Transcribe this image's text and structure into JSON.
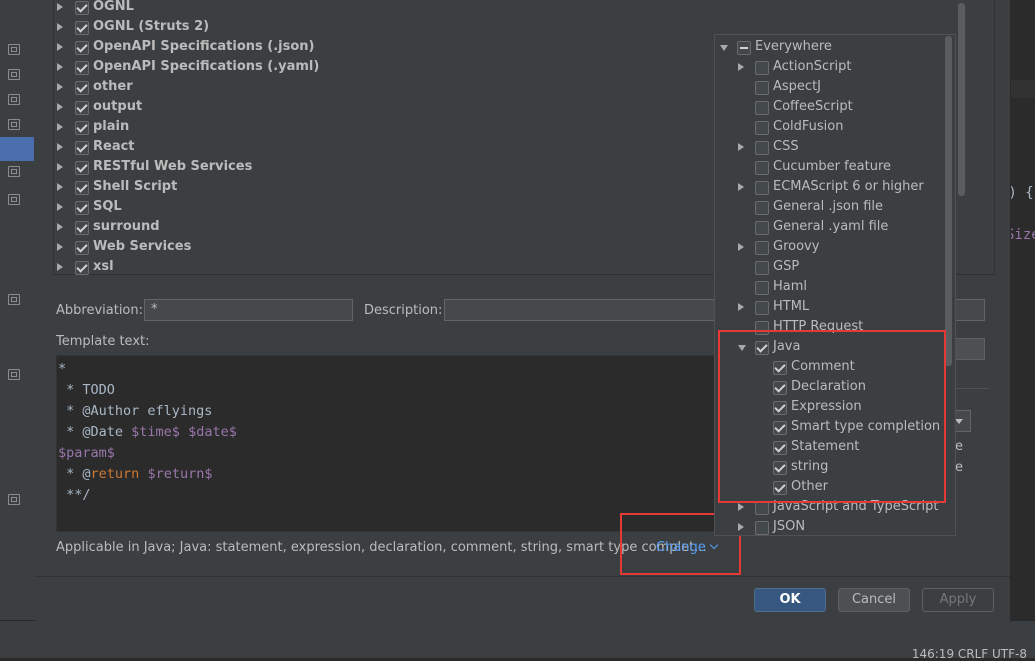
{
  "ide": {
    "code_fragment_1": "e) {",
    "code_fragment_2": "Size",
    "status": "146:19   CRLF   UTF-8"
  },
  "template_groups": [
    {
      "label": "OGNL",
      "checked": true
    },
    {
      "label": "OGNL (Struts 2)",
      "checked": true
    },
    {
      "label": "OpenAPI Specifications (.json)",
      "checked": true
    },
    {
      "label": "OpenAPI Specifications (.yaml)",
      "checked": true
    },
    {
      "label": "other",
      "checked": true
    },
    {
      "label": "output",
      "checked": true
    },
    {
      "label": "plain",
      "checked": true
    },
    {
      "label": "React",
      "checked": true
    },
    {
      "label": "RESTful Web Services",
      "checked": true
    },
    {
      "label": "Shell Script",
      "checked": true
    },
    {
      "label": "SQL",
      "checked": true
    },
    {
      "label": "surround",
      "checked": true
    },
    {
      "label": "Web Services",
      "checked": true
    },
    {
      "label": "xsl",
      "checked": true
    }
  ],
  "form": {
    "abbreviation_label": "Abbreviation:",
    "abbreviation_value": "*",
    "description_label": "Description:",
    "description_value": "",
    "template_text_label": "Template text:",
    "template_lines": [
      {
        "text": "*"
      },
      {
        "text": " * TODO"
      },
      {
        "text": " * @Author eflyings"
      },
      {
        "prefix": " * @Date ",
        "var1": "$time$",
        "sep": " ",
        "var2": "$date$"
      },
      {
        "var": "$param$"
      },
      {
        "prefix": " * @",
        "kw": "return",
        "sep": " ",
        "var": "$return$"
      },
      {
        "text": " **/"
      }
    ],
    "applicable_text": "Applicable in Java; Java: statement, expression, declaration, comment, string, smart type complet...",
    "change_link": "Change",
    "edge_text_1": "e",
    "edge_text_2": "e"
  },
  "buttons": {
    "ok": "OK",
    "cancel": "Cancel",
    "apply": "Apply"
  },
  "context_popup": {
    "items": [
      {
        "label": "Everywhere",
        "state": "partial",
        "level": 0,
        "arrow": "down"
      },
      {
        "label": "ActionScript",
        "state": "unchecked",
        "level": 1,
        "arrow": "right"
      },
      {
        "label": "AspectJ",
        "state": "unchecked",
        "level": 1,
        "arrow": "none"
      },
      {
        "label": "CoffeeScript",
        "state": "unchecked",
        "level": 1,
        "arrow": "none"
      },
      {
        "label": "ColdFusion",
        "state": "unchecked",
        "level": 1,
        "arrow": "none"
      },
      {
        "label": "CSS",
        "state": "unchecked",
        "level": 1,
        "arrow": "right"
      },
      {
        "label": "Cucumber feature",
        "state": "unchecked",
        "level": 1,
        "arrow": "none"
      },
      {
        "label": "ECMAScript 6 or higher",
        "state": "unchecked",
        "level": 1,
        "arrow": "right"
      },
      {
        "label": "General .json file",
        "state": "unchecked",
        "level": 1,
        "arrow": "none"
      },
      {
        "label": "General .yaml file",
        "state": "unchecked",
        "level": 1,
        "arrow": "none"
      },
      {
        "label": "Groovy",
        "state": "unchecked",
        "level": 1,
        "arrow": "right"
      },
      {
        "label": "GSP",
        "state": "unchecked",
        "level": 1,
        "arrow": "none"
      },
      {
        "label": "Haml",
        "state": "unchecked",
        "level": 1,
        "arrow": "none"
      },
      {
        "label": "HTML",
        "state": "unchecked",
        "level": 1,
        "arrow": "right"
      },
      {
        "label": "HTTP Request",
        "state": "unchecked",
        "level": 1,
        "arrow": "none"
      },
      {
        "label": "Java",
        "state": "checked",
        "level": 1,
        "arrow": "down"
      },
      {
        "label": "Comment",
        "state": "checked",
        "level": 2,
        "arrow": "none"
      },
      {
        "label": "Declaration",
        "state": "checked",
        "level": 2,
        "arrow": "none"
      },
      {
        "label": "Expression",
        "state": "checked",
        "level": 2,
        "arrow": "none"
      },
      {
        "label": "Smart type completion",
        "state": "checked",
        "level": 2,
        "arrow": "none"
      },
      {
        "label": "Statement",
        "state": "checked",
        "level": 2,
        "arrow": "none"
      },
      {
        "label": "string",
        "state": "checked",
        "level": 2,
        "arrow": "none"
      },
      {
        "label": "Other",
        "state": "checked",
        "level": 2,
        "arrow": "none"
      },
      {
        "label": "JavaScript and TypeScript",
        "state": "unchecked",
        "level": 1,
        "arrow": "right"
      },
      {
        "label": "JSON",
        "state": "unchecked",
        "level": 1,
        "arrow": "right"
      }
    ]
  },
  "colors": {
    "highlight_box": "#e53935",
    "link": "#589df6",
    "ok_button": "#365880"
  }
}
